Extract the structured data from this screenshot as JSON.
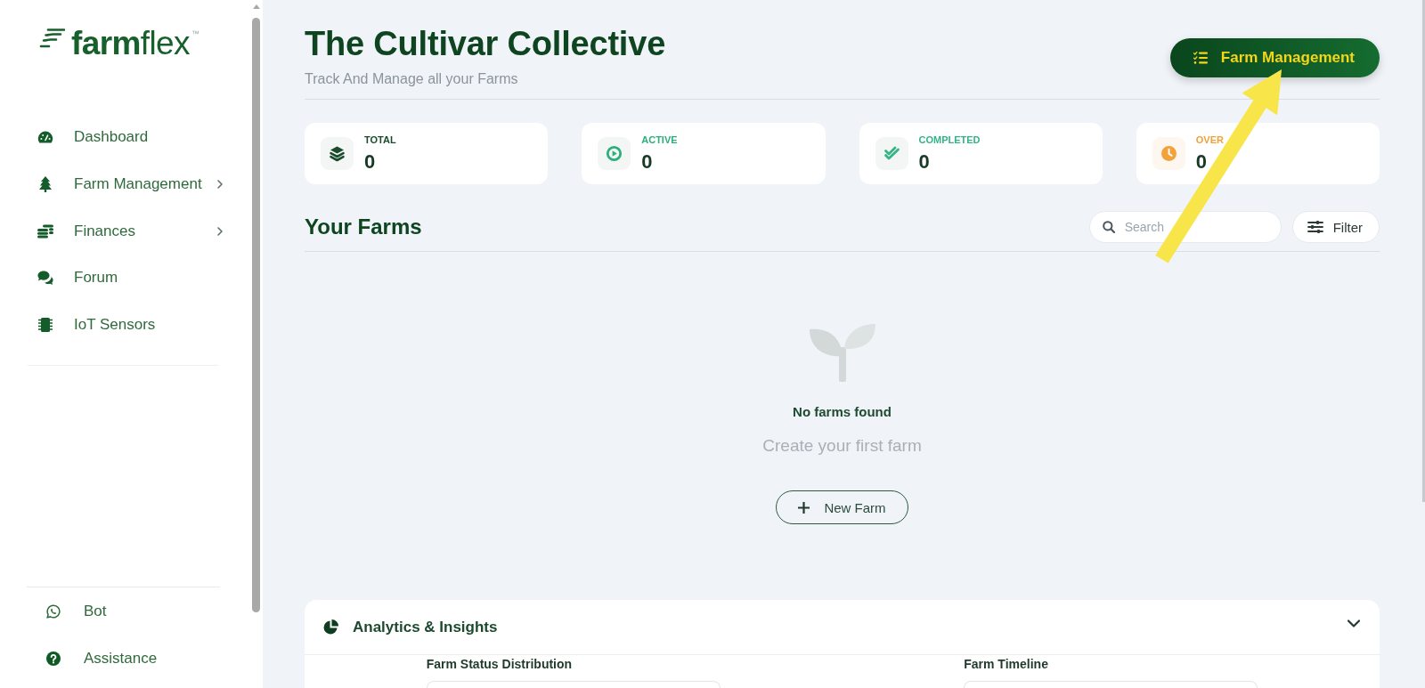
{
  "sidebar": {
    "logo": "**farm**flex$^{™}$",
    "nav_items": [
      {
        "label": "Dashboard",
        "has_submenu": false,
        "selected": false
      },
      {
        "label": "Farm Management",
        "has_submenu": true,
        "selected": false
      },
      {
        "label": "Finances",
        "has_submenu": true,
        "selected": false
      },
      {
        "label": "Forum",
        "has_submenu": false,
        "selected": false
      },
      {
        "label": "IoT Sensors",
        "has_submenu": false,
        "selected": false
      }
    ],
    "footer_items": [
      {
        "label": "Bot"
      },
      {
        "label": "Assistance"
      }
    ]
  },
  "header": {
    "title": "The Cultivar Collective",
    "subtitle": "Track And Manage all your Farms",
    "action_button": "Farm Management"
  },
  "stats": [
    {
      "label": "TOTAL",
      "value": "0",
      "color": "#1b4a2c"
    },
    {
      "label": "ACTIVE",
      "value": "0",
      "color": "#2bb07b"
    },
    {
      "label": "COMPLETED",
      "value": "0",
      "color": "#34b386"
    },
    {
      "label": "OVER",
      "value": "0",
      "color": "#f2a23a"
    }
  ],
  "farms": {
    "title": "Your Farms",
    "search": {
      "placeholder": "Search"
    },
    "filter_button": "Filter",
    "empty_state": {
      "title": "No farms found",
      "message": "Create your first farm",
      "button": "New Farm"
    }
  },
  "analytics": {
    "title": "Analytics & Insights",
    "expanded": true,
    "panels": [
      {
        "title": "Farm Status Distribution"
      },
      {
        "title": "Farm Timeline"
      }
    ]
  }
}
